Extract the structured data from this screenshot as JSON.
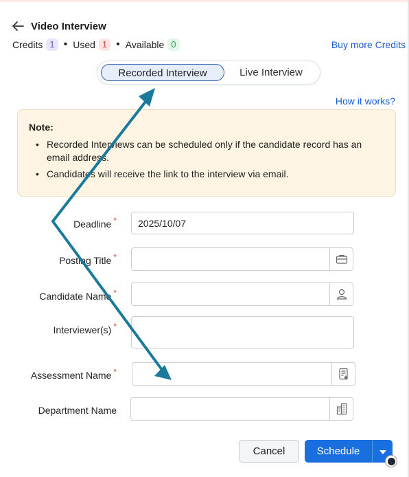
{
  "header": {
    "title": "Video Interview",
    "back_icon": "arrow-left-icon"
  },
  "credits": {
    "credits_label": "Credits",
    "credits_value": "1",
    "used_label": "Used",
    "used_value": "1",
    "available_label": "Available",
    "available_value": "0",
    "separator": "•",
    "buy_more_label": "Buy more Credits"
  },
  "toggle": {
    "recorded_label": "Recorded Interview",
    "live_label": "Live Interview",
    "selected": "Recorded Interview"
  },
  "how_it_works_label": "How it works?",
  "note": {
    "title": "Note:",
    "items": [
      "Recorded Interviews can be scheduled only if the candidate record has an email address.",
      "Candidates will receive the link to the interview via email."
    ]
  },
  "form": {
    "required_mark": "*",
    "deadline": {
      "label": "Deadline",
      "value": "2025/10/07"
    },
    "posting_title": {
      "label": "Posting Title",
      "value": "",
      "icon": "briefcase-icon"
    },
    "candidate_name": {
      "label": "Candidate Name",
      "value": "",
      "icon": "user-icon"
    },
    "interviewers": {
      "label": "Interviewer(s)",
      "value": ""
    },
    "assessment_name": {
      "label": "Assessment Name",
      "value": "",
      "icon": "document-list-icon"
    },
    "department_name": {
      "label": "Department Name",
      "value": "",
      "icon": "building-icon"
    }
  },
  "footer": {
    "cancel_label": "Cancel",
    "schedule_label": "Schedule",
    "dropdown_icon": "caret-down-icon"
  },
  "colors": {
    "accent_blue": "#1a6fe0",
    "link_blue": "#1a5fd0",
    "annotation_arrow": "#1a7a9c",
    "note_bg": "#fdf4e3",
    "required_red": "#e0443a"
  }
}
